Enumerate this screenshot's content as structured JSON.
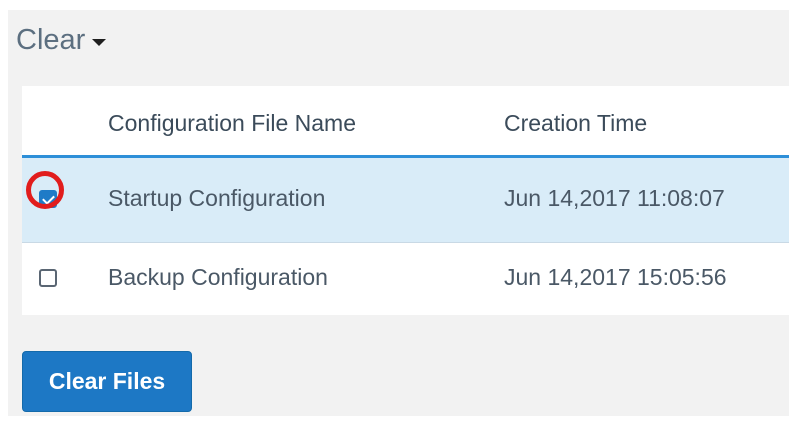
{
  "header": {
    "title": "Clear",
    "icon": "caret-down-icon"
  },
  "table": {
    "columns": [
      "",
      "Configuration File Name",
      "Creation Time"
    ],
    "rows": [
      {
        "selected": true,
        "name": "Startup Configuration",
        "creation_time": "Jun 14,2017 11:08:07"
      },
      {
        "selected": false,
        "name": "Backup Configuration",
        "creation_time": "Jun 14,2017 15:05:56"
      }
    ]
  },
  "actions": {
    "clear_files_label": "Clear Files"
  },
  "colors": {
    "panel_background": "#f2f2f2",
    "selected_row_background": "#d9ecf8",
    "accent_blue": "#1d78c5",
    "header_rule_blue": "#2d8fd8",
    "highlight_red": "#e11d1d"
  }
}
